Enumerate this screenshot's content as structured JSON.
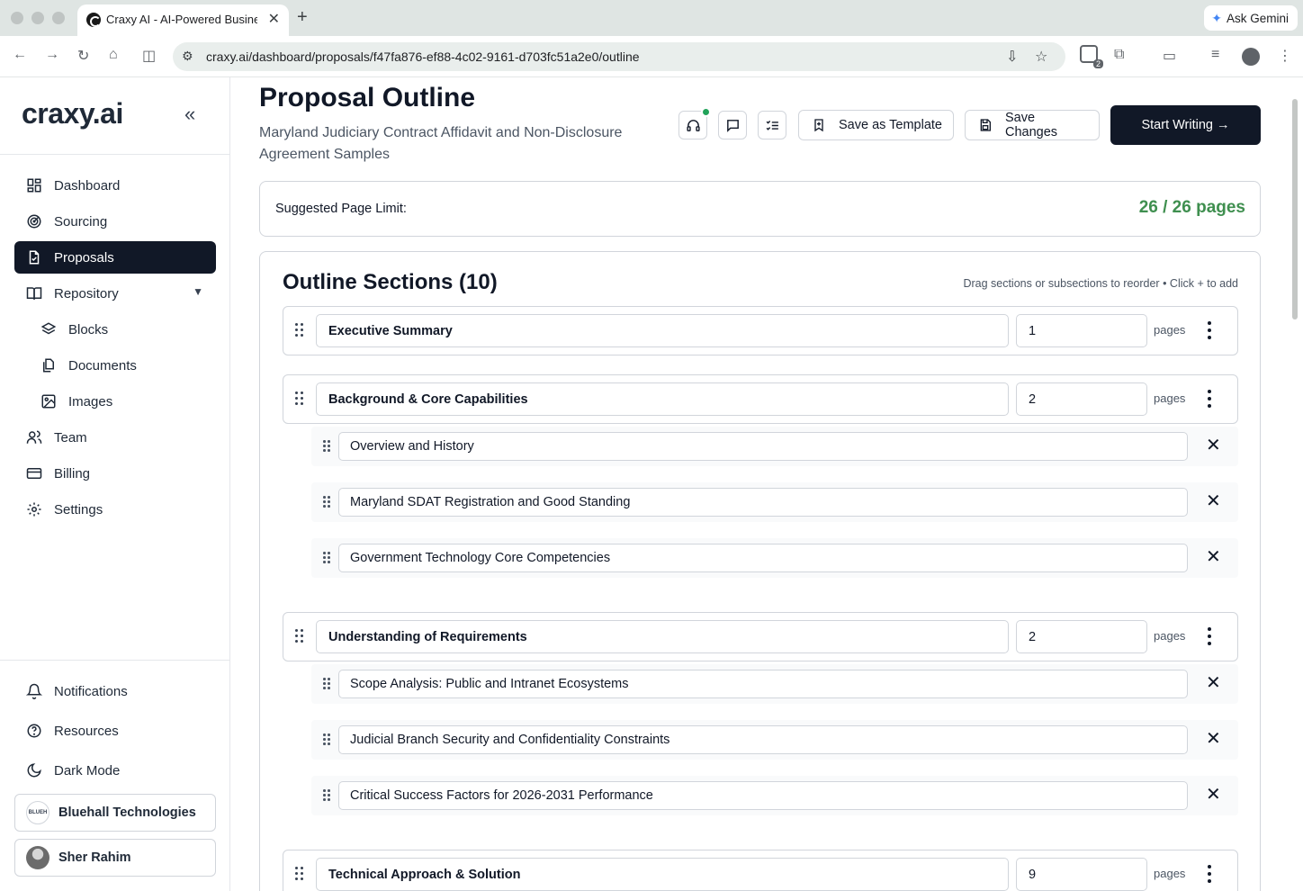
{
  "browser": {
    "tab_title": "Craxy AI - AI-Powered Busine",
    "tab_close": "✕",
    "new_tab": "+",
    "ask_gemini": "Ask Gemini",
    "url": "craxy.ai/dashboard/proposals/f47fa876-ef88-4c02-9161-d703fc51a2e0/outline",
    "extension_badge": "2"
  },
  "sidebar": {
    "logo": "craxy.ai",
    "collapse_icon": "«",
    "nav": [
      {
        "label": "Dashboard",
        "icon": "dashboard-icon"
      },
      {
        "label": "Sourcing",
        "icon": "radar-icon"
      },
      {
        "label": "Proposals",
        "icon": "file-check-icon",
        "active": true
      },
      {
        "label": "Repository",
        "icon": "book-icon",
        "expandable": true
      },
      {
        "label": "Blocks",
        "icon": "layers-icon"
      },
      {
        "label": "Documents",
        "icon": "documents-icon"
      },
      {
        "label": "Images",
        "icon": "image-icon"
      },
      {
        "label": "Team",
        "icon": "users-icon"
      },
      {
        "label": "Billing",
        "icon": "credit-card-icon"
      },
      {
        "label": "Settings",
        "icon": "gear-icon"
      }
    ],
    "bottom": [
      {
        "label": "Notifications",
        "icon": "bell-icon"
      },
      {
        "label": "Resources",
        "icon": "help-circle-icon"
      },
      {
        "label": "Dark Mode",
        "icon": "moon-icon"
      }
    ],
    "organization": "Bluehall Technologies",
    "organization_logo_text": "BLUEH",
    "user": "Sher Rahim"
  },
  "header": {
    "title": "Proposal Outline",
    "subtitle": "Maryland Judiciary Contract Affidavit and Non-Disclosure Agreement Samples",
    "save_template": "Save as Template",
    "save_changes": "Save Changes",
    "start_writing": "Start Writing →"
  },
  "page_limit": {
    "label": "Suggested Page Limit:",
    "value": "26 / 26 pages"
  },
  "outline": {
    "title": "Outline Sections (10)",
    "hint": "Drag sections or subsections to reorder • Click + to add",
    "pages_label": "pages",
    "remove_icon": "✕",
    "sections": [
      {
        "title": "Executive Summary",
        "pages": "1",
        "subsections": []
      },
      {
        "title": "Background & Core Capabilities",
        "pages": "2",
        "subsections": [
          "Overview and History",
          "Maryland SDAT Registration and Good Standing",
          "Government Technology Core Competencies"
        ]
      },
      {
        "title": "Understanding of Requirements",
        "pages": "2",
        "subsections": [
          "Scope Analysis: Public and Intranet Ecosystems",
          "Judicial Branch Security and Confidentiality Constraints",
          "Critical Success Factors for 2026-2031 Performance"
        ]
      },
      {
        "title": "Technical Approach & Solution",
        "pages": "9",
        "subsections": []
      }
    ]
  },
  "colors": {
    "primary": "#111827",
    "limit_green": "#3f8f4f",
    "notification_dot": "#22a35a"
  }
}
